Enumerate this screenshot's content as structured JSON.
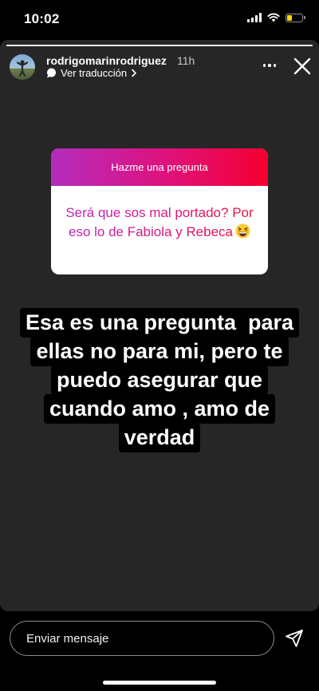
{
  "status_bar": {
    "time": "10:02",
    "battery_level": 0.35,
    "battery_color": "#ffd60a"
  },
  "story": {
    "progress": 1.0,
    "username": "rodrigomarinrodriguez",
    "time_ago": "11h",
    "translate_link": "Ver traducción",
    "more_icon": "more-horizontal-icon",
    "close_icon": "close-icon"
  },
  "question_sticker": {
    "header": "Hazme una pregunta",
    "question": "Será que sos mal portado? Por eso lo de Fabiola y Rebeca",
    "emoji": "grinning-squinting-face-emoji",
    "gradient": [
      "#b42cbe",
      "#e0117a",
      "#f4002e"
    ]
  },
  "answer": {
    "lines": [
      "Esa es una pregunta  para",
      "ellas no para mi, pero te",
      "puedo asegurar que",
      "cuando amo , amo de",
      "verdad"
    ]
  },
  "reply": {
    "placeholder": "Enviar mensaje",
    "send_icon": "send-icon"
  }
}
